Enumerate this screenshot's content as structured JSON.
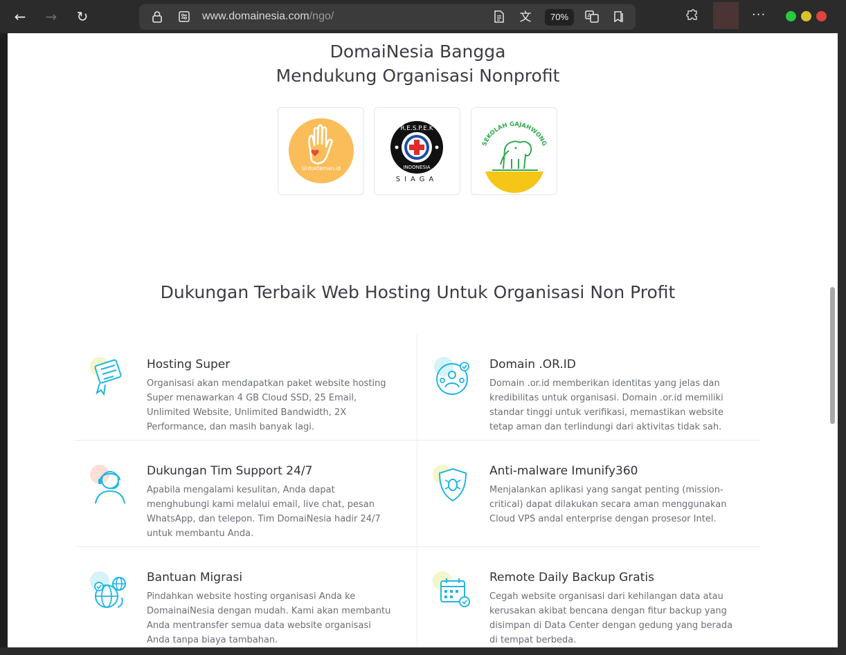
{
  "browser": {
    "url_host": "www.domainesia.com",
    "url_path": "/ngo/",
    "zoom": "70%"
  },
  "hero": {
    "title_line1": "DomaiNesia Bangga",
    "title_line2": "Mendukung Organisasi Nonprofit",
    "logos": [
      {
        "name": "untukteman",
        "text": "Untukteman.id"
      },
      {
        "name": "respek",
        "text_top": "R.E.S.P.E.K",
        "text_mid": "INDONESIA",
        "text_bottom": "SIAGA"
      },
      {
        "name": "gajahwong",
        "text": "SEKOLAH GAJAHWONG"
      }
    ]
  },
  "section": {
    "title": "Dukungan Terbaik Web Hosting Untuk Organisasi Non Profit"
  },
  "features": [
    {
      "title": "Hosting Super",
      "desc": "Organisasi akan mendapatkan paket website hosting Super menawarkan 4 GB Cloud SSD, 25 Email, Unlimited Website, Unlimited Bandwidth, 2X Performance, dan masih banyak lagi.",
      "icon": "server-award-icon"
    },
    {
      "title": "Domain .OR.ID",
      "desc": "Domain .or.id memberikan identitas yang jelas dan kredibilitas untuk organisasi. Domain .or.id memiliki standar tinggi untuk verifikasi, memastikan website tetap aman dan terlindungi dari aktivitas tidak sah.",
      "icon": "globe-people-icon"
    },
    {
      "title": "Dukungan Tim Support 24/7",
      "desc": "Apabila mengalami kesulitan, Anda dapat menghubungi kami melalui email, live chat, pesan WhatsApp, dan telepon. Tim DomaiNesia hadir 24/7 untuk membantu Anda.",
      "icon": "headset-support-icon"
    },
    {
      "title": "Anti-malware Imunify360",
      "desc": "Menjalankan aplikasi yang sangat penting (mission-critical) dapat dilakukan secara aman menggunakan Cloud VPS andal enterprise dengan prosesor Intel.",
      "icon": "shield-bug-icon"
    },
    {
      "title": "Bantuan Migrasi",
      "desc": "Pindahkan website hosting organisasi Anda ke DomainaiNesia dengan mudah. Kami akan membantu Anda mentransfer semua data website organisasi Anda tanpa biaya tambahan.",
      "icon": "globe-migrate-icon"
    },
    {
      "title": "Remote Daily Backup Gratis",
      "desc": "Cegah website organisasi dari kehilangan data atau kerusakan akibat bencana dengan fitur backup yang disimpan di Data Center dengan gedung yang berada di tempat berbeda.",
      "icon": "calendar-backup-icon"
    }
  ],
  "colors": {
    "accent": "#1fb6e3",
    "blob_yellow": "#f3f7c9",
    "blob_peach": "#fde0d5",
    "blob_cyan": "#d5f3f8"
  }
}
